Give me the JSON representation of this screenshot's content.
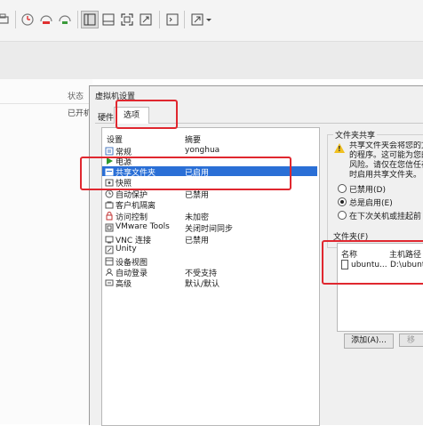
{
  "toolbar": {
    "icons": [
      "print-icon",
      "snapshot-icon",
      "revert-snapshot-icon",
      "snapshot-manager-icon",
      "console-view-icon",
      "thumbnail-view-icon",
      "fit-guest-icon",
      "unity-icon",
      "terminal-icon",
      "fullscreen-icon",
      "dropdown-arrow-icon"
    ]
  },
  "background": {
    "status_header": "状态",
    "status_value": "已开机"
  },
  "dialog": {
    "title": "虚拟机设置",
    "tabs": [
      {
        "label": "硬件",
        "active": false
      },
      {
        "label": "选项",
        "active": true
      }
    ],
    "list": {
      "header_setting": "设置",
      "header_summary": "摘要",
      "rows": [
        {
          "icon": "general-icon",
          "name": "常规",
          "summary": "yonghua"
        },
        {
          "icon": "power-icon",
          "name": "电源",
          "summary": ""
        },
        {
          "icon": "shared-folder-icon",
          "name": "共享文件夹",
          "summary": "已启用",
          "selected": true
        },
        {
          "icon": "snapshot-icon",
          "name": "快照",
          "summary": ""
        },
        {
          "icon": "autoprotect-icon",
          "name": "自动保护",
          "summary": "已禁用"
        },
        {
          "icon": "guest-isolation-icon",
          "name": "客户机隔离",
          "summary": ""
        },
        {
          "icon": "access-control-icon",
          "name": "访问控制",
          "summary": "未加密"
        },
        {
          "icon": "vmware-tools-icon",
          "name": "VMware Tools",
          "summary": "关闭时间同步"
        },
        {
          "icon": "vnc-icon",
          "name": "VNC 连接",
          "summary": "已禁用"
        },
        {
          "icon": "unity-icon",
          "name": "Unity",
          "summary": ""
        },
        {
          "icon": "appliance-view-icon",
          "name": "设备视图",
          "summary": ""
        },
        {
          "icon": "autologin-icon",
          "name": "自动登录",
          "summary": "不受支持"
        },
        {
          "icon": "advanced-icon",
          "name": "高级",
          "summary": "默认/默认"
        }
      ]
    },
    "sharing": {
      "title": "文件夹共享",
      "description": [
        "共享文件夹会将您的文",
        "的程序。这可能为您的",
        "风险。请仅在您信任在",
        "时启用共享文件夹。"
      ],
      "options": [
        {
          "label": "已禁用(D)",
          "checked": false
        },
        {
          "label": "总是启用(E)",
          "checked": true
        },
        {
          "label": "在下次关机或挂起前",
          "checked": false
        }
      ]
    },
    "folders": {
      "title": "文件夹(F)",
      "col_name": "名称",
      "col_path": "主机路径",
      "items": [
        {
          "name": "ubuntu...",
          "path": "D:\\ubuntu"
        }
      ],
      "add_button": "添加(A)...",
      "remove_button": "移"
    }
  },
  "colors": {
    "selection": "#2a6fd6",
    "annotation_red": "#e0272f",
    "dialog_bg": "#f0f0f0"
  }
}
